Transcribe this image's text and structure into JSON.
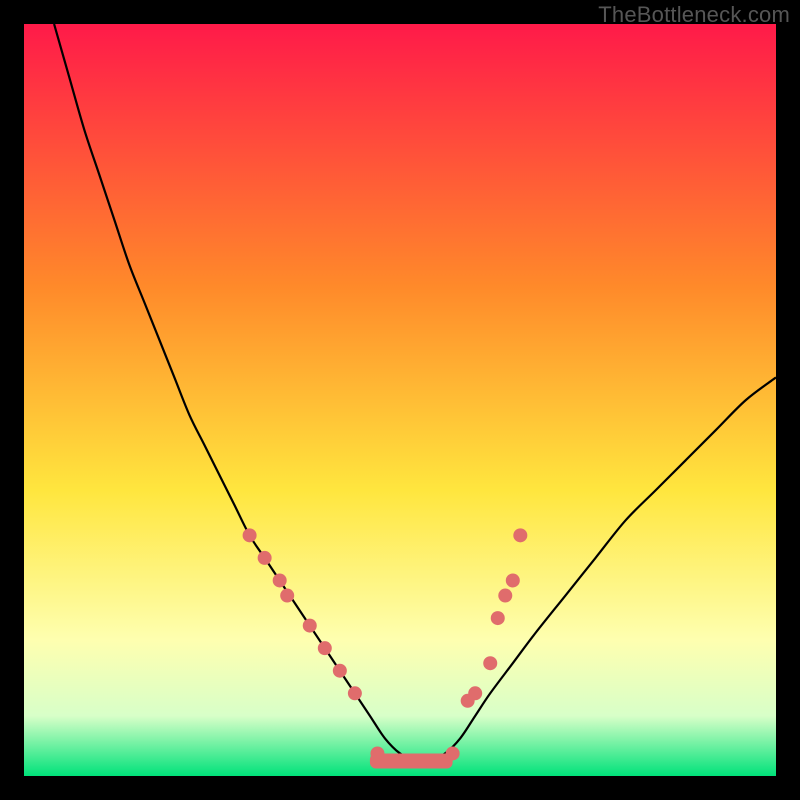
{
  "watermark": "TheBottleneck.com",
  "colors": {
    "gradient_top": "#ff1a49",
    "gradient_mid1": "#ff8a2a",
    "gradient_mid2": "#ffe63e",
    "gradient_mid3": "#feffb0",
    "gradient_bottom_band": "#d8ffc8",
    "gradient_bottom": "#00e27a",
    "curve": "#000000",
    "dot": "#e06c6c",
    "frame": "#000000"
  },
  "chart_data": {
    "type": "line",
    "title": "",
    "xlabel": "",
    "ylabel": "",
    "xlim": [
      0,
      100
    ],
    "ylim": [
      0,
      100
    ],
    "series": [
      {
        "name": "bottleneck-curve",
        "x": [
          4,
          6,
          8,
          10,
          12,
          14,
          16,
          18,
          20,
          22,
          24,
          26,
          28,
          30,
          32,
          34,
          36,
          38,
          40,
          42,
          44,
          46,
          48,
          50,
          52,
          54,
          56,
          58,
          60,
          62,
          65,
          68,
          72,
          76,
          80,
          84,
          88,
          92,
          96,
          100
        ],
        "y": [
          100,
          93,
          86,
          80,
          74,
          68,
          63,
          58,
          53,
          48,
          44,
          40,
          36,
          32,
          29,
          26,
          23,
          20,
          17,
          14,
          11,
          8,
          5,
          3,
          2,
          2,
          3,
          5,
          8,
          11,
          15,
          19,
          24,
          29,
          34,
          38,
          42,
          46,
          50,
          53
        ]
      }
    ],
    "dots": {
      "name": "sample-points",
      "points": [
        {
          "x": 30,
          "y": 32
        },
        {
          "x": 32,
          "y": 29
        },
        {
          "x": 34,
          "y": 26
        },
        {
          "x": 35,
          "y": 24
        },
        {
          "x": 38,
          "y": 20
        },
        {
          "x": 40,
          "y": 17
        },
        {
          "x": 42,
          "y": 14
        },
        {
          "x": 44,
          "y": 11
        },
        {
          "x": 47,
          "y": 3
        },
        {
          "x": 49,
          "y": 2
        },
        {
          "x": 51,
          "y": 2
        },
        {
          "x": 53,
          "y": 2
        },
        {
          "x": 55,
          "y": 2
        },
        {
          "x": 57,
          "y": 3
        },
        {
          "x": 59,
          "y": 10
        },
        {
          "x": 60,
          "y": 11
        },
        {
          "x": 62,
          "y": 15
        },
        {
          "x": 63,
          "y": 21
        },
        {
          "x": 64,
          "y": 24
        },
        {
          "x": 65,
          "y": 26
        },
        {
          "x": 66,
          "y": 32
        }
      ]
    },
    "valley_band": {
      "y_from": 1,
      "y_to": 3,
      "x_from": 46,
      "x_to": 57
    }
  }
}
